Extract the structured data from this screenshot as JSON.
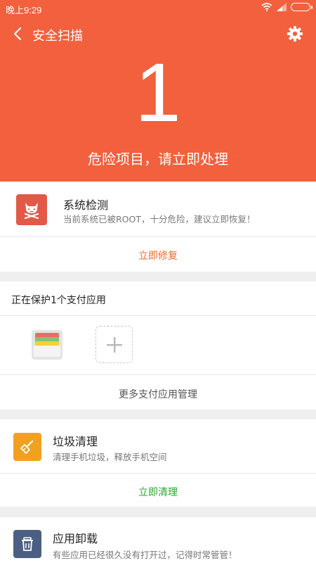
{
  "status": {
    "time": "晚上9:29"
  },
  "header": {
    "title": "安全扫描"
  },
  "summary": {
    "count": "1",
    "message": "危险项目，请立即处理"
  },
  "system_check": {
    "title": "系统检测",
    "description": "当前系统已被ROOT，十分危险，建议立即恢复！",
    "action": "立即修复"
  },
  "payment": {
    "title": "正在保护1个支付应用",
    "manage": "更多支付应用管理"
  },
  "junk": {
    "title": "垃圾清理",
    "description": "清理手机垃圾，释放手机空间",
    "action": "立即清理"
  },
  "uninstall": {
    "title": "应用卸载",
    "description": "有些应用已经很久没有打开过，记得时常管管！"
  },
  "colors": {
    "hero": "#f2603d",
    "danger_icon": "#e05a47",
    "orange_action": "#f06a2c",
    "green_action": "#2aa52e",
    "junk_icon": "#f2a11f",
    "uninstall_icon": "#4b5f83"
  },
  "icons": [
    "back-icon",
    "settings-gear-icon",
    "wifi-icon",
    "signal-icon",
    "battery-icon",
    "devil-icon",
    "wallet-icon",
    "plus-icon",
    "broom-icon",
    "trash-icon"
  ]
}
